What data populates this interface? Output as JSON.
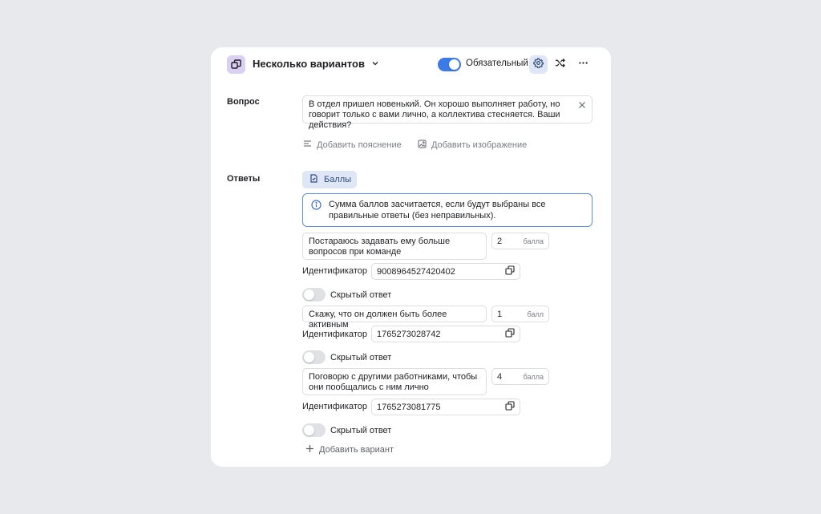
{
  "header": {
    "type_title": "Несколько вариантов",
    "required_label": "Обязательный",
    "required_on": true
  },
  "question": {
    "label": "Вопрос",
    "text": "В отдел пришел новенький. Он хорошо выполняет работу, но говорит только с вами лично, а коллектива стесняется. Ваши действия?",
    "add_hint": "Добавить пояснение",
    "add_image": "Добавить изображение"
  },
  "answers": {
    "label": "Ответы",
    "scores_button": "Баллы",
    "info": "Сумма баллов засчитается, если будут выбраны все правильные ответы (без неправильных).",
    "id_label": "Идентификатор",
    "hidden_label": "Скрытый ответ",
    "items": [
      {
        "text": "Постараюсь задавать ему больше вопросов при команде",
        "score": "2",
        "unit": "балла",
        "id": "9008964527420402",
        "hidden": false
      },
      {
        "text": "Скажу, что он должен быть более активным",
        "score": "1",
        "unit": "балл",
        "id": "1765273028742",
        "hidden": false
      },
      {
        "text": "Поговорю с другими работниками, чтобы они пообщались с ним лично",
        "score": "4",
        "unit": "балла",
        "id": "1765273081775",
        "hidden": false
      }
    ],
    "add_variant": "Добавить вариант"
  }
}
